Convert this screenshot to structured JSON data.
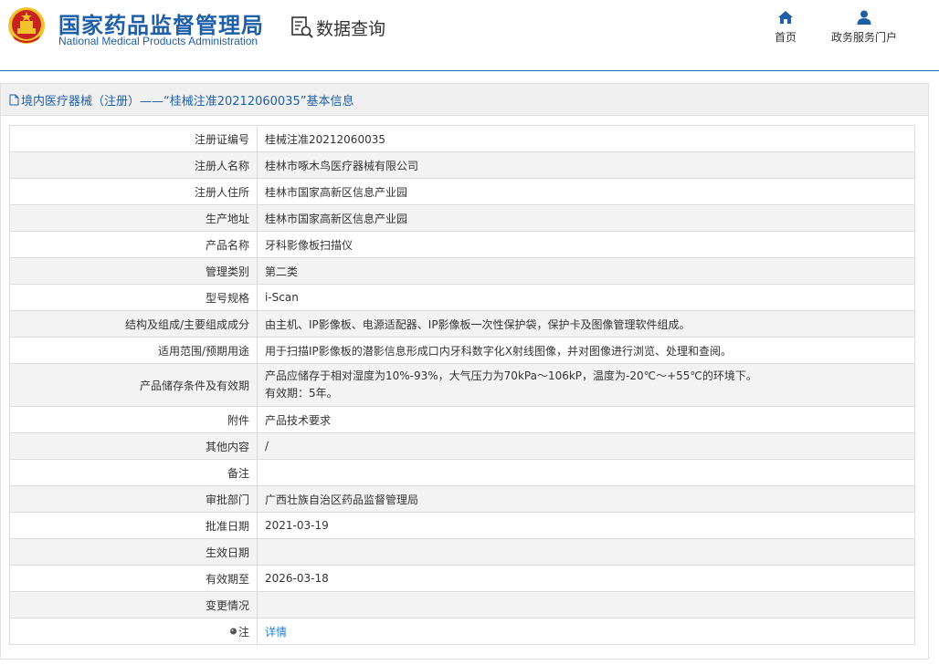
{
  "header": {
    "brand_cn": "国家药品监督管理局",
    "brand_en": "National Medical Products Administration",
    "query_label": "数据查询",
    "nav": [
      {
        "label": "首页",
        "icon": "home-icon"
      },
      {
        "label": "政务服务门户",
        "icon": "user-icon"
      }
    ]
  },
  "panel": {
    "title": "境内医疗器械（注册）——“桂械注准20212060035”基本信息"
  },
  "rows": [
    {
      "label": "注册证编号",
      "value": "桂械注准20212060035"
    },
    {
      "label": "注册人名称",
      "value": "桂林市啄木鸟医疗器械有限公司"
    },
    {
      "label": "注册人住所",
      "value": "桂林市国家高新区信息产业园"
    },
    {
      "label": "生产地址",
      "value": "桂林市国家高新区信息产业园"
    },
    {
      "label": "产品名称",
      "value": "牙科影像板扫描仪"
    },
    {
      "label": "管理类别",
      "value": "第二类"
    },
    {
      "label": "型号规格",
      "value": "i-Scan"
    },
    {
      "label": "结构及组成/主要组成成分",
      "value": "由主机、IP影像板、电源适配器、IP影像板一次性保护袋，保护卡及图像管理软件组成。"
    },
    {
      "label": "适用范围/预期用途",
      "value": "用于扫描IP影像板的潜影信息形成口内牙科数字化X射线图像，并对图像进行浏览、处理和查阅。"
    },
    {
      "label": "产品储存条件及有效期",
      "value_line1": "产品应储存于相对湿度为10%-93%，大气压力为70kPa～106kP，温度为-20℃～+55℃的环境下。",
      "value_line2": "有效期：5年。"
    },
    {
      "label": "附件",
      "value": "产品技术要求"
    },
    {
      "label": "其他内容",
      "value": "/"
    },
    {
      "label": "备注",
      "value": ""
    },
    {
      "label": "审批部门",
      "value": "广西壮族自治区药品监督管理局"
    },
    {
      "label": "批准日期",
      "value": "2021-03-19"
    },
    {
      "label": "生效日期",
      "value": ""
    },
    {
      "label": "有效期至",
      "value": "2026-03-18"
    },
    {
      "label": "变更情况",
      "value": ""
    },
    {
      "label": "注",
      "value": "详情"
    }
  ],
  "colors": {
    "brand_blue": "#1e5fa7",
    "link_blue": "#1e7fd0",
    "emblem_red": "#c8231e",
    "emblem_gold": "#f2c12e"
  }
}
